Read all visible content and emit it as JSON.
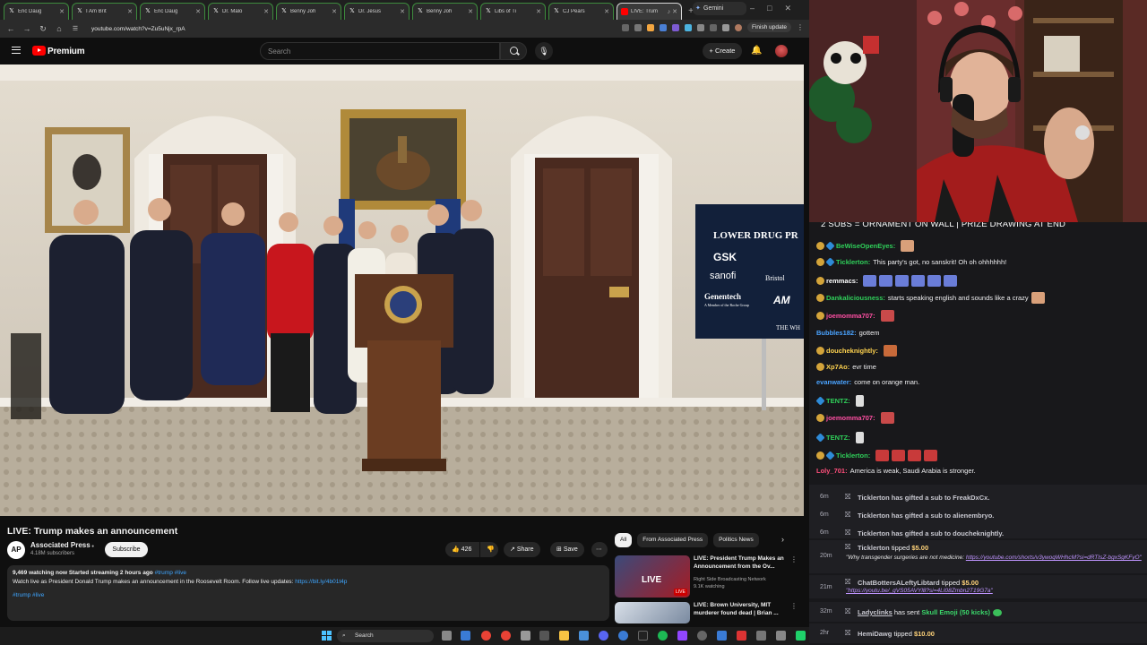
{
  "browser": {
    "tabs": [
      {
        "label": "Eric Daug",
        "icon": "x-logo-icon"
      },
      {
        "label": "I Am Brit",
        "icon": "x-logo-icon"
      },
      {
        "label": "Eric Daug",
        "icon": "x-logo-icon"
      },
      {
        "label": "Dr. Malo",
        "icon": "x-logo-icon"
      },
      {
        "label": "Benny Joh",
        "icon": "x-logo-icon"
      },
      {
        "label": "Dr. Jesus",
        "icon": "x-logo-icon"
      },
      {
        "label": "Benny Joh",
        "icon": "x-logo-icon"
      },
      {
        "label": "Libs of Ti",
        "icon": "x-logo-icon"
      },
      {
        "label": "CJ Pears",
        "icon": "x-logo-icon"
      },
      {
        "label": "LIVE: Trum",
        "icon": "youtube-icon",
        "active": true
      }
    ],
    "gemini_tab": "Gemini",
    "url": "youtube.com/watch?v=Zu5uNjx_rpA",
    "finish_update": "Finish update"
  },
  "youtube": {
    "logo_text": "Premium",
    "search_placeholder": "Search",
    "create_label": "Create",
    "video": {
      "title": "LIVE: Trump makes an announcement",
      "channel": "Associated Press",
      "channel_avatar": "AP",
      "subscribers": "4.18M subscribers",
      "subscribe": "Subscribe",
      "likes": "426",
      "share": "Share",
      "save": "Save",
      "desc_stats": "9,469 watching now  Started streaming 2 hours ago",
      "desc_tags": "#trump #live",
      "desc_text": "Watch live as President Donald Trump makes an announcement in the Roosevelt Room. Follow live updates:",
      "desc_link": "https://bit.ly/4b01t4p",
      "desc_tags2": "#trump #live",
      "sign": {
        "headline": "LOWER DRUG PR",
        "logos": [
          "GSK",
          "sanofi",
          "Bristol",
          "Genentech",
          "AM"
        ],
        "sub": "A Member of the Roche Group",
        "footer": "THE WH"
      }
    },
    "chips": [
      "All",
      "From Associated Press",
      "Politics News"
    ],
    "recommendations": [
      {
        "title": "LIVE: President Trump Makes an Announcement from the Ov...",
        "channel": "Right Side Broadcasting Network",
        "meta": "9.1K watching",
        "badge": "LIVE"
      },
      {
        "title": "LIVE: Brown University, MIT murderer found dead | Brian ...",
        "channel": "",
        "meta": ""
      }
    ]
  },
  "taskbar": {
    "search_label": "Search"
  },
  "chat": {
    "banner": "2 SUBS = ORNAMENT ON WALL | PRIZE DRAWING AT END",
    "messages": [
      {
        "user": "BeWiseOpenEyes:",
        "text": "",
        "color": "#2fd05a",
        "badges": [
          "gold",
          "blue"
        ],
        "emote": "#d9a07a"
      },
      {
        "user": "Ticklerton:",
        "text": "This party's got, no sanskrit! Oh oh ohhhhhh!",
        "color": "#2fd05a",
        "badges": [
          "gold",
          "blue"
        ]
      },
      {
        "user": "remmacs:",
        "text": "",
        "color": "#ffffff",
        "badges": [
          "gold"
        ],
        "emote": "#6a7dd8"
      },
      {
        "user": "Dankaliciousness:",
        "text": "starts speaking english and sounds like a crazy",
        "color": "#2fd05a",
        "badges": [
          "gold"
        ],
        "emote": "#d9a07a"
      },
      {
        "user": "joemomma707:",
        "text": "",
        "color": "#ff4fa3",
        "badges": [
          "gold"
        ],
        "emote": "#c94a4a"
      },
      {
        "user": "Bubbles182:",
        "text": "gottem",
        "color": "#4aa3ff",
        "badges": []
      },
      {
        "user": "doucheknightly:",
        "text": "",
        "color": "#ffd34f",
        "badges": [
          "gold"
        ],
        "emote": "#c86a3a"
      },
      {
        "user": "Xp7Ao:",
        "text": "evr time",
        "color": "#ffd34f",
        "badges": [
          "gold"
        ]
      },
      {
        "user": "evanwater:",
        "text": "come on orange man.",
        "color": "#4aa3ff",
        "badges": []
      },
      {
        "user": "TENTZ:",
        "text": "",
        "color": "#2fd05a",
        "badges": [
          "blue"
        ],
        "emote": "#dddddd"
      },
      {
        "user": "joemomma707:",
        "text": "",
        "color": "#ff4fa3",
        "badges": [
          "gold"
        ],
        "emote": "#c94a4a"
      },
      {
        "user": "TENTZ:",
        "text": "",
        "color": "#2fd05a",
        "badges": [
          "blue"
        ],
        "emote": "#dddddd"
      },
      {
        "user": "Ticklerton:",
        "text": "",
        "color": "#2fd05a",
        "badges": [
          "gold",
          "blue"
        ],
        "emote": "#c83a3a"
      },
      {
        "user": "Loly_701:",
        "text": "America is weak, Saudi Arabia is stronger.",
        "color": "#ff4f7b",
        "badges": []
      }
    ],
    "events": [
      {
        "time": "6m",
        "text": "Ticklerton has gifted a sub to FreakDxCx."
      },
      {
        "time": "6m",
        "text": "Ticklerton has gifted a sub to alienembryo."
      },
      {
        "time": "6m",
        "text": "Ticklerton has gifted a sub to doucheknightly."
      },
      {
        "time": "20m",
        "user": "Ticklerton",
        "action": "tipped",
        "amount": "$5.00",
        "note": "\"Why transgender surgeries are not medicine:",
        "note_link": "https://youtube.com/shorts/v3ywoqWHhcM?si=dRTIsZ-bgxSgKFyO\""
      },
      {
        "time": "21m",
        "user": "ChatBottersALeftyLibtard",
        "action": "tipped",
        "amount": "$5.00",
        "note": "",
        "note_link": "\"https://youtu.be/_gVS05AVYl8?si=4LI08Zmbn2T19G7a\""
      },
      {
        "time": "32m",
        "user": "Ladyclinks",
        "action": "has sent",
        "amount": "Skull Emoji (50 kicks)",
        "note": "",
        "note_link": ""
      },
      {
        "time": "2hr",
        "user": "HemiDawg",
        "action": "tipped",
        "amount": "$10.00",
        "note": "",
        "note_link": ""
      }
    ]
  }
}
